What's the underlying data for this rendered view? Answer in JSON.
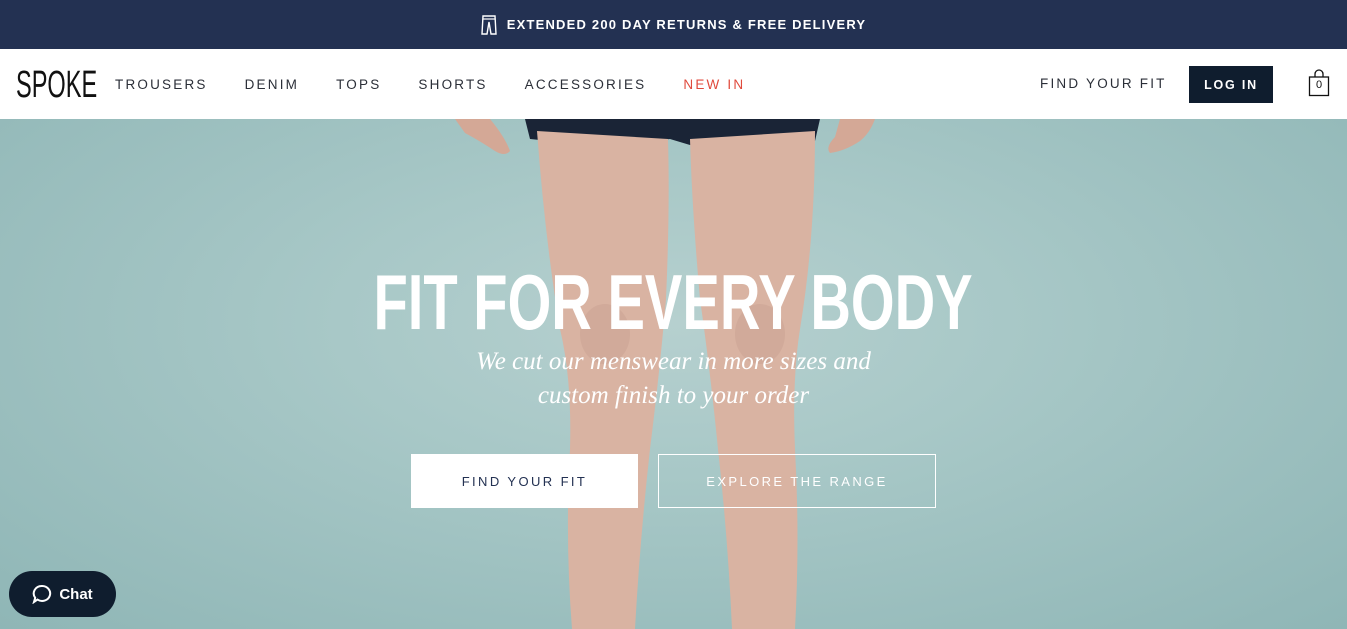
{
  "promo": {
    "text": "EXTENDED 200 DAY RETURNS & FREE DELIVERY",
    "icon": "trousers-icon"
  },
  "nav": {
    "logo": "SPOKE",
    "links": [
      "TROUSERS",
      "DENIM",
      "TOPS",
      "SHORTS",
      "ACCESSORIES",
      "NEW IN"
    ],
    "find_fit": "FIND YOUR FIT",
    "login": "LOG IN",
    "bag_count": "0"
  },
  "hero": {
    "headline": "FIT FOR EVERY BODY",
    "subline_1": "We cut our menswear in more sizes and",
    "subline_2": "custom finish to your order",
    "primary_button": "FIND YOUR FIT",
    "secondary_button": "EXPLORE THE RANGE"
  },
  "chat": {
    "label": "Chat"
  },
  "colors": {
    "promo_bg": "#233152",
    "accent_new": "#e04a3c",
    "login_bg": "#0f1d2e",
    "hero_bg": "#a8c8c7"
  }
}
